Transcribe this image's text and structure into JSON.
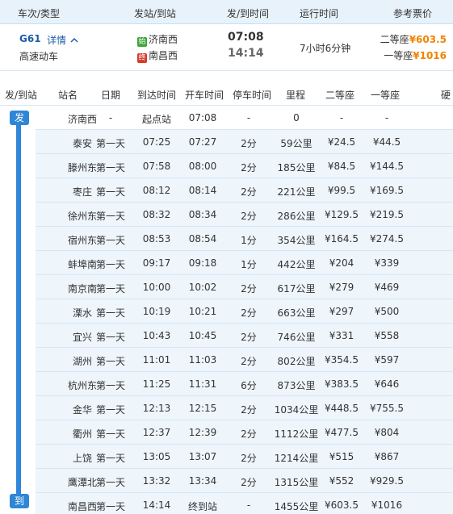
{
  "header": {
    "train": "车次/类型",
    "stations": "发站/到站",
    "times": "发/到时间",
    "duration": "运行时间",
    "prices": "参考票价"
  },
  "train": {
    "number": "G61",
    "detail": "详情",
    "type": "高速动车",
    "from_tag": "始",
    "from": "济南西",
    "to_tag": "终",
    "to": "南昌西",
    "depart": "07:08",
    "arrive": "14:14",
    "duration": "7小时6分钟",
    "price1_label": "二等座",
    "price1": "¥603.5",
    "price2_label": "一等座",
    "price2": "¥1016"
  },
  "stops_header": {
    "route": "发/到站",
    "name": "站名",
    "date": "日期",
    "arrive": "到达时间",
    "depart": "开车时间",
    "stop": "停车时间",
    "distance": "里程",
    "second": "二等座",
    "first": "一等座",
    "hard": "硬"
  },
  "route_tags": {
    "start": "发",
    "end": "到"
  },
  "stops": [
    {
      "name": "济南西",
      "date": "-",
      "arrive": "起点站",
      "depart": "07:08",
      "stop": "-",
      "distance": "0",
      "second": "-",
      "first": "-"
    },
    {
      "name": "泰安",
      "date": "第一天",
      "arrive": "07:25",
      "depart": "07:27",
      "stop": "2分",
      "distance": "59公里",
      "second": "¥24.5",
      "first": "¥44.5"
    },
    {
      "name": "滕州东",
      "date": "第一天",
      "arrive": "07:58",
      "depart": "08:00",
      "stop": "2分",
      "distance": "185公里",
      "second": "¥84.5",
      "first": "¥144.5"
    },
    {
      "name": "枣庄",
      "date": "第一天",
      "arrive": "08:12",
      "depart": "08:14",
      "stop": "2分",
      "distance": "221公里",
      "second": "¥99.5",
      "first": "¥169.5"
    },
    {
      "name": "徐州东",
      "date": "第一天",
      "arrive": "08:32",
      "depart": "08:34",
      "stop": "2分",
      "distance": "286公里",
      "second": "¥129.5",
      "first": "¥219.5"
    },
    {
      "name": "宿州东",
      "date": "第一天",
      "arrive": "08:53",
      "depart": "08:54",
      "stop": "1分",
      "distance": "354公里",
      "second": "¥164.5",
      "first": "¥274.5"
    },
    {
      "name": "蚌埠南",
      "date": "第一天",
      "arrive": "09:17",
      "depart": "09:18",
      "stop": "1分",
      "distance": "442公里",
      "second": "¥204",
      "first": "¥339"
    },
    {
      "name": "南京南",
      "date": "第一天",
      "arrive": "10:00",
      "depart": "10:02",
      "stop": "2分",
      "distance": "617公里",
      "second": "¥279",
      "first": "¥469"
    },
    {
      "name": "溧水",
      "date": "第一天",
      "arrive": "10:19",
      "depart": "10:21",
      "stop": "2分",
      "distance": "663公里",
      "second": "¥297",
      "first": "¥500"
    },
    {
      "name": "宜兴",
      "date": "第一天",
      "arrive": "10:43",
      "depart": "10:45",
      "stop": "2分",
      "distance": "746公里",
      "second": "¥331",
      "first": "¥558"
    },
    {
      "name": "湖州",
      "date": "第一天",
      "arrive": "11:01",
      "depart": "11:03",
      "stop": "2分",
      "distance": "802公里",
      "second": "¥354.5",
      "first": "¥597"
    },
    {
      "name": "杭州东",
      "date": "第一天",
      "arrive": "11:25",
      "depart": "11:31",
      "stop": "6分",
      "distance": "873公里",
      "second": "¥383.5",
      "first": "¥646"
    },
    {
      "name": "金华",
      "date": "第一天",
      "arrive": "12:13",
      "depart": "12:15",
      "stop": "2分",
      "distance": "1034公里",
      "second": "¥448.5",
      "first": "¥755.5"
    },
    {
      "name": "衢州",
      "date": "第一天",
      "arrive": "12:37",
      "depart": "12:39",
      "stop": "2分",
      "distance": "1112公里",
      "second": "¥477.5",
      "first": "¥804"
    },
    {
      "name": "上饶",
      "date": "第一天",
      "arrive": "13:05",
      "depart": "13:07",
      "stop": "2分",
      "distance": "1214公里",
      "second": "¥515",
      "first": "¥867"
    },
    {
      "name": "鹰潭北",
      "date": "第一天",
      "arrive": "13:32",
      "depart": "13:34",
      "stop": "2分",
      "distance": "1315公里",
      "second": "¥552",
      "first": "¥929.5"
    },
    {
      "name": "南昌西",
      "date": "第一天",
      "arrive": "14:14",
      "depart": "终到站",
      "stop": "-",
      "distance": "1455公里",
      "second": "¥603.5",
      "first": "¥1016"
    }
  ],
  "colors": {
    "accent": "#2f86d6",
    "price": "#f08300",
    "link": "#1b5da8"
  }
}
